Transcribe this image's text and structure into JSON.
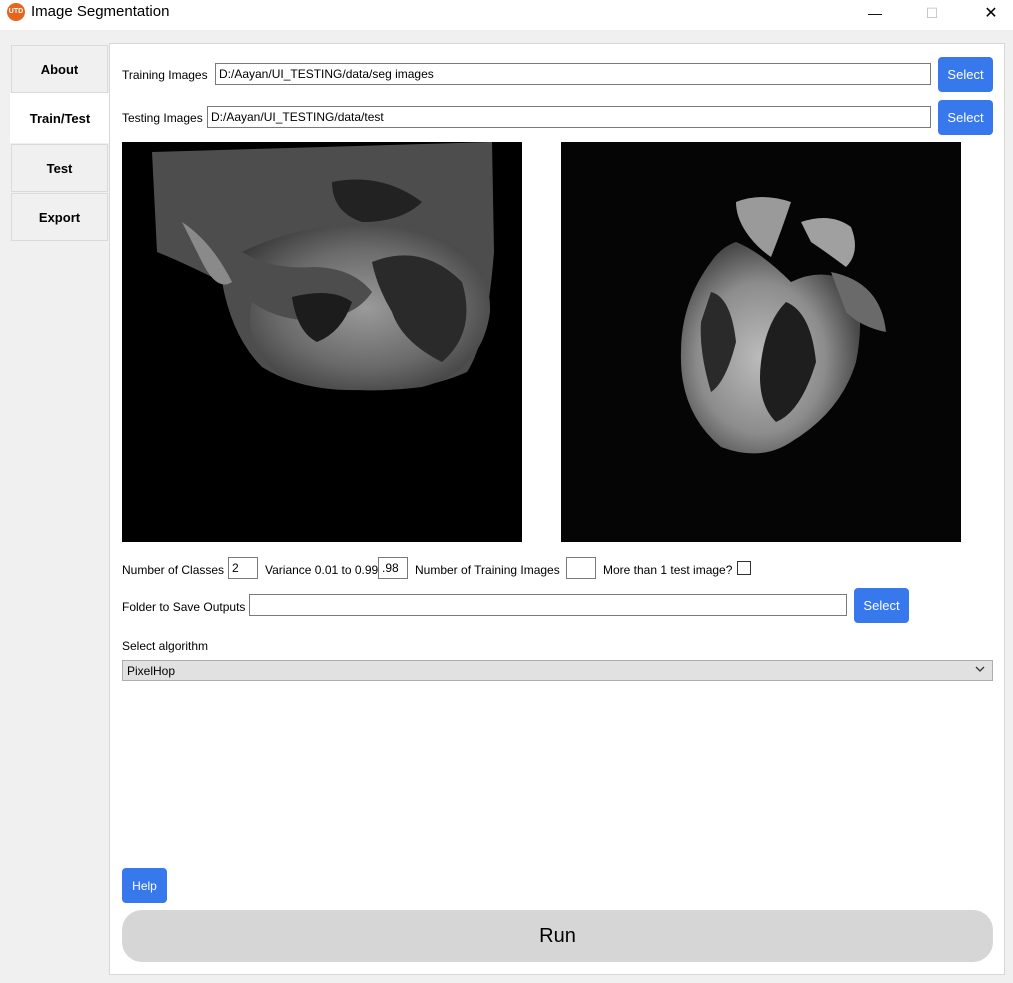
{
  "window": {
    "title": "Image Segmentation",
    "app_icon_text": "UTD",
    "minimize_glyph": "—",
    "maximize_glyph": "☐",
    "close_glyph": "✕"
  },
  "tabs": [
    {
      "label": "About"
    },
    {
      "label": "Train/Test",
      "active": true
    },
    {
      "label": "Test"
    },
    {
      "label": "Export"
    }
  ],
  "training": {
    "label": "Training Images",
    "value": "D:/Aayan/UI_TESTING/data/seg images",
    "button": "Select"
  },
  "testing": {
    "label": "Testing Images",
    "value": "D:/Aayan/UI_TESTING/data/test",
    "button": "Select"
  },
  "params": {
    "classes_label": "Number of Classes",
    "classes_value": "2",
    "variance_label": "Variance 0.01 to 0.99",
    "variance_value": ".98",
    "training_count_label": "Number of Training Images",
    "training_count_value": "",
    "multi_test_label": "More than 1 test image?",
    "multi_test_checked": false
  },
  "outputs": {
    "label": "Folder to Save Outputs",
    "value": "",
    "button": "Select"
  },
  "algorithm": {
    "label": "Select algorithm",
    "selected": "PixelHop"
  },
  "help_button": "Help",
  "run_button": "Run",
  "colors": {
    "accent": "#3779ec",
    "run_bg": "#d6d6d6"
  }
}
